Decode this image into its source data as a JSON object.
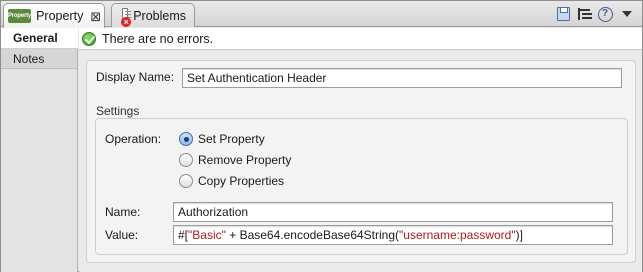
{
  "tabs": [
    {
      "label": "Property",
      "icon": "property-icon",
      "icon_text": "Property",
      "active": true
    },
    {
      "label": "Problems",
      "icon": "problems-icon",
      "active": false
    }
  ],
  "toolbar": {
    "icons": [
      "save-icon",
      "tree-icon",
      "help-icon",
      "view-menu-icon"
    ],
    "help_glyph": "?"
  },
  "status": {
    "message": "There are no errors.",
    "icon": "ok-check-icon"
  },
  "sidebar": {
    "items": [
      {
        "label": "General",
        "active": true
      },
      {
        "label": "Notes",
        "active": false
      }
    ]
  },
  "form": {
    "display_name_label": "Display Name:",
    "display_name_value": "Set Authentication Header",
    "settings_title": "Settings",
    "operation_label": "Operation:",
    "operations": [
      {
        "label": "Set Property",
        "checked": true
      },
      {
        "label": "Remove Property",
        "checked": false
      },
      {
        "label": "Copy Properties",
        "checked": false
      }
    ],
    "name_label": "Name:",
    "name_value": "Authorization",
    "value_label": "Value:",
    "value_parts": {
      "prefix": "#[",
      "str1": "\"Basic\"",
      "mid": " + Base64.encodeBase64String(",
      "str2": "\"username:password\"",
      "suffix": ")]"
    }
  },
  "colors": {
    "accent": "#3a6db5",
    "ok": "#2f9a1e",
    "string_literal": "#b01a1a"
  }
}
